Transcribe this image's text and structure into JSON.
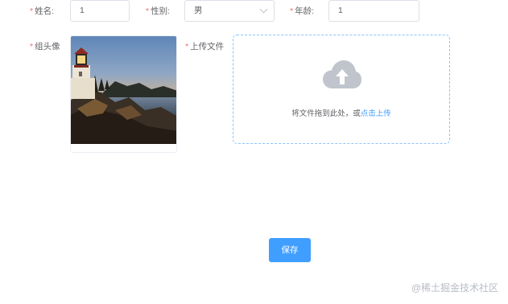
{
  "form": {
    "name": {
      "required_mark": "*",
      "label": "姓名:",
      "value": "1"
    },
    "gender": {
      "required_mark": "*",
      "label": "性别:",
      "value": "男"
    },
    "age": {
      "required_mark": "*",
      "label": "年龄:",
      "value": "1"
    },
    "avatar": {
      "required_mark": "*",
      "label": "组头像"
    },
    "upload": {
      "required_mark": "*",
      "label": "上传文件",
      "hint": "将文件拖到此处，或",
      "link": "点击上传"
    }
  },
  "save_label": "保存",
  "watermark": "@稀土掘金技术社区",
  "colors": {
    "accent": "#409eff",
    "required": "#f56c6c",
    "border": "#dcdfe6",
    "dropzone_border": "#8cc5ff",
    "cloud_icon": "#c0c4cc"
  },
  "icons": {
    "upload": "cloud-upload-icon",
    "select": "chevron-down-icon"
  }
}
